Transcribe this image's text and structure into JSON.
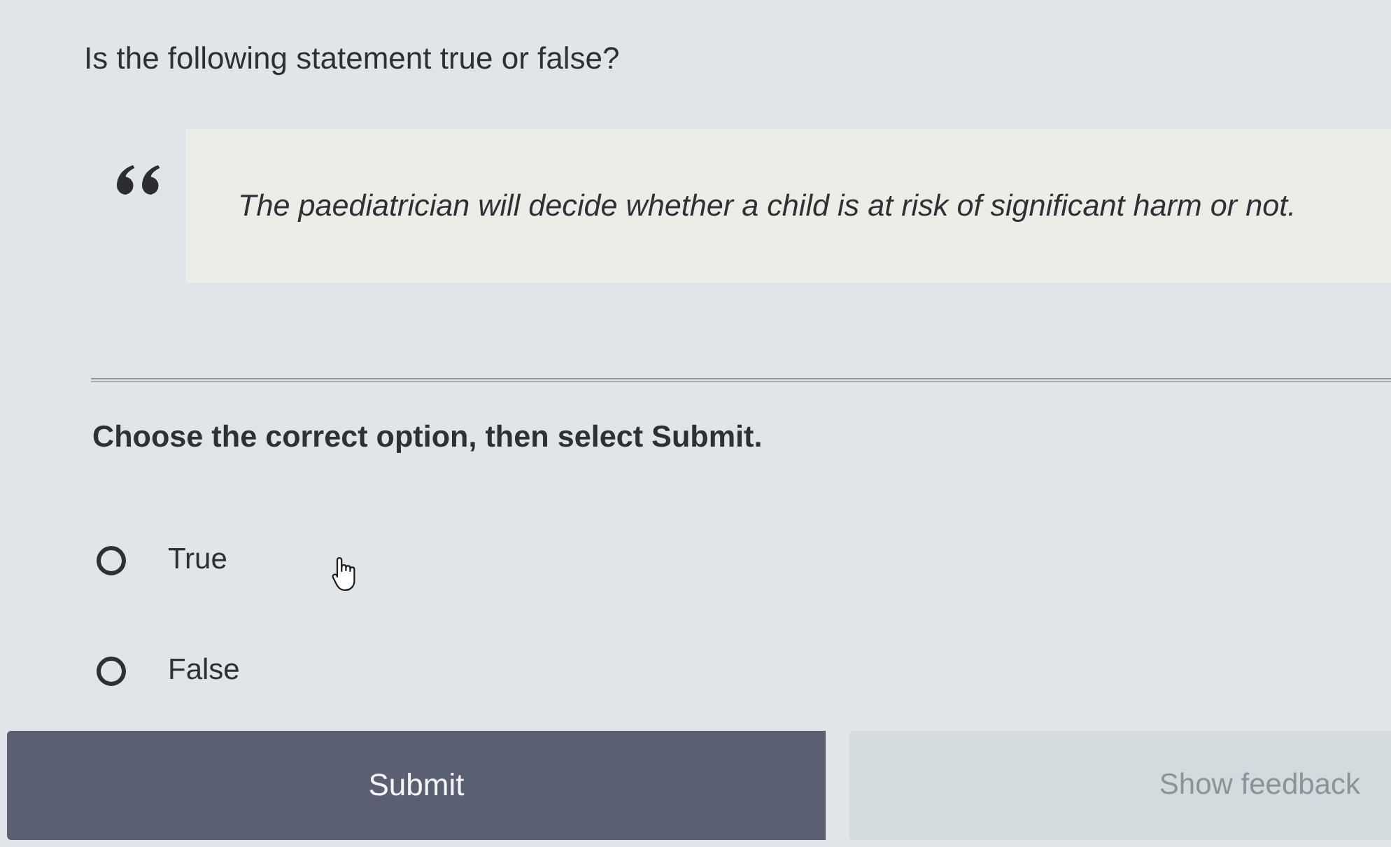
{
  "question": {
    "prompt": "Is the following statement true or false?",
    "statement": "The paediatrician will decide whether a child is at risk of significant harm or not."
  },
  "instruction": "Choose the correct option, then select Submit.",
  "options": [
    {
      "label": "True",
      "selected": false
    },
    {
      "label": "False",
      "selected": false
    }
  ],
  "buttons": [
    {
      "label": "Submit",
      "kind": "primary",
      "disabled": false
    },
    {
      "label": "Show feedback",
      "kind": "secondary",
      "disabled": true
    }
  ]
}
